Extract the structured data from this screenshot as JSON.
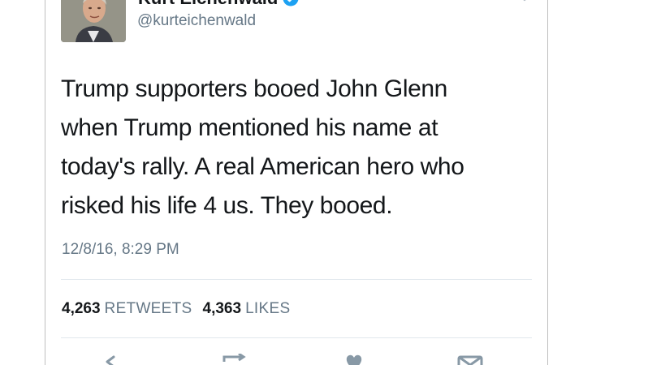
{
  "tweet": {
    "author": {
      "display_name": "Kurt Eichenwald",
      "handle": "@kurteichenwald",
      "verified": true
    },
    "text_lines": [
      "Trump supporters booed John Glenn",
      "when Trump mentioned his name at",
      "today's rally. A real American hero who",
      "risked his life 4 us. They booed."
    ],
    "timestamp": "12/8/16, 8:29 PM",
    "stats": {
      "retweets_count": "4,263",
      "retweets_label": "RETWEETS",
      "likes_count": "4,363",
      "likes_label": "LIKES"
    },
    "actions": [
      "reply-icon",
      "retweet-icon",
      "like-icon",
      "message-icon"
    ],
    "colors": {
      "text": "#14171a",
      "secondary": "#657786",
      "verified": "#1da1f2",
      "divider": "#e1e8ed"
    }
  }
}
